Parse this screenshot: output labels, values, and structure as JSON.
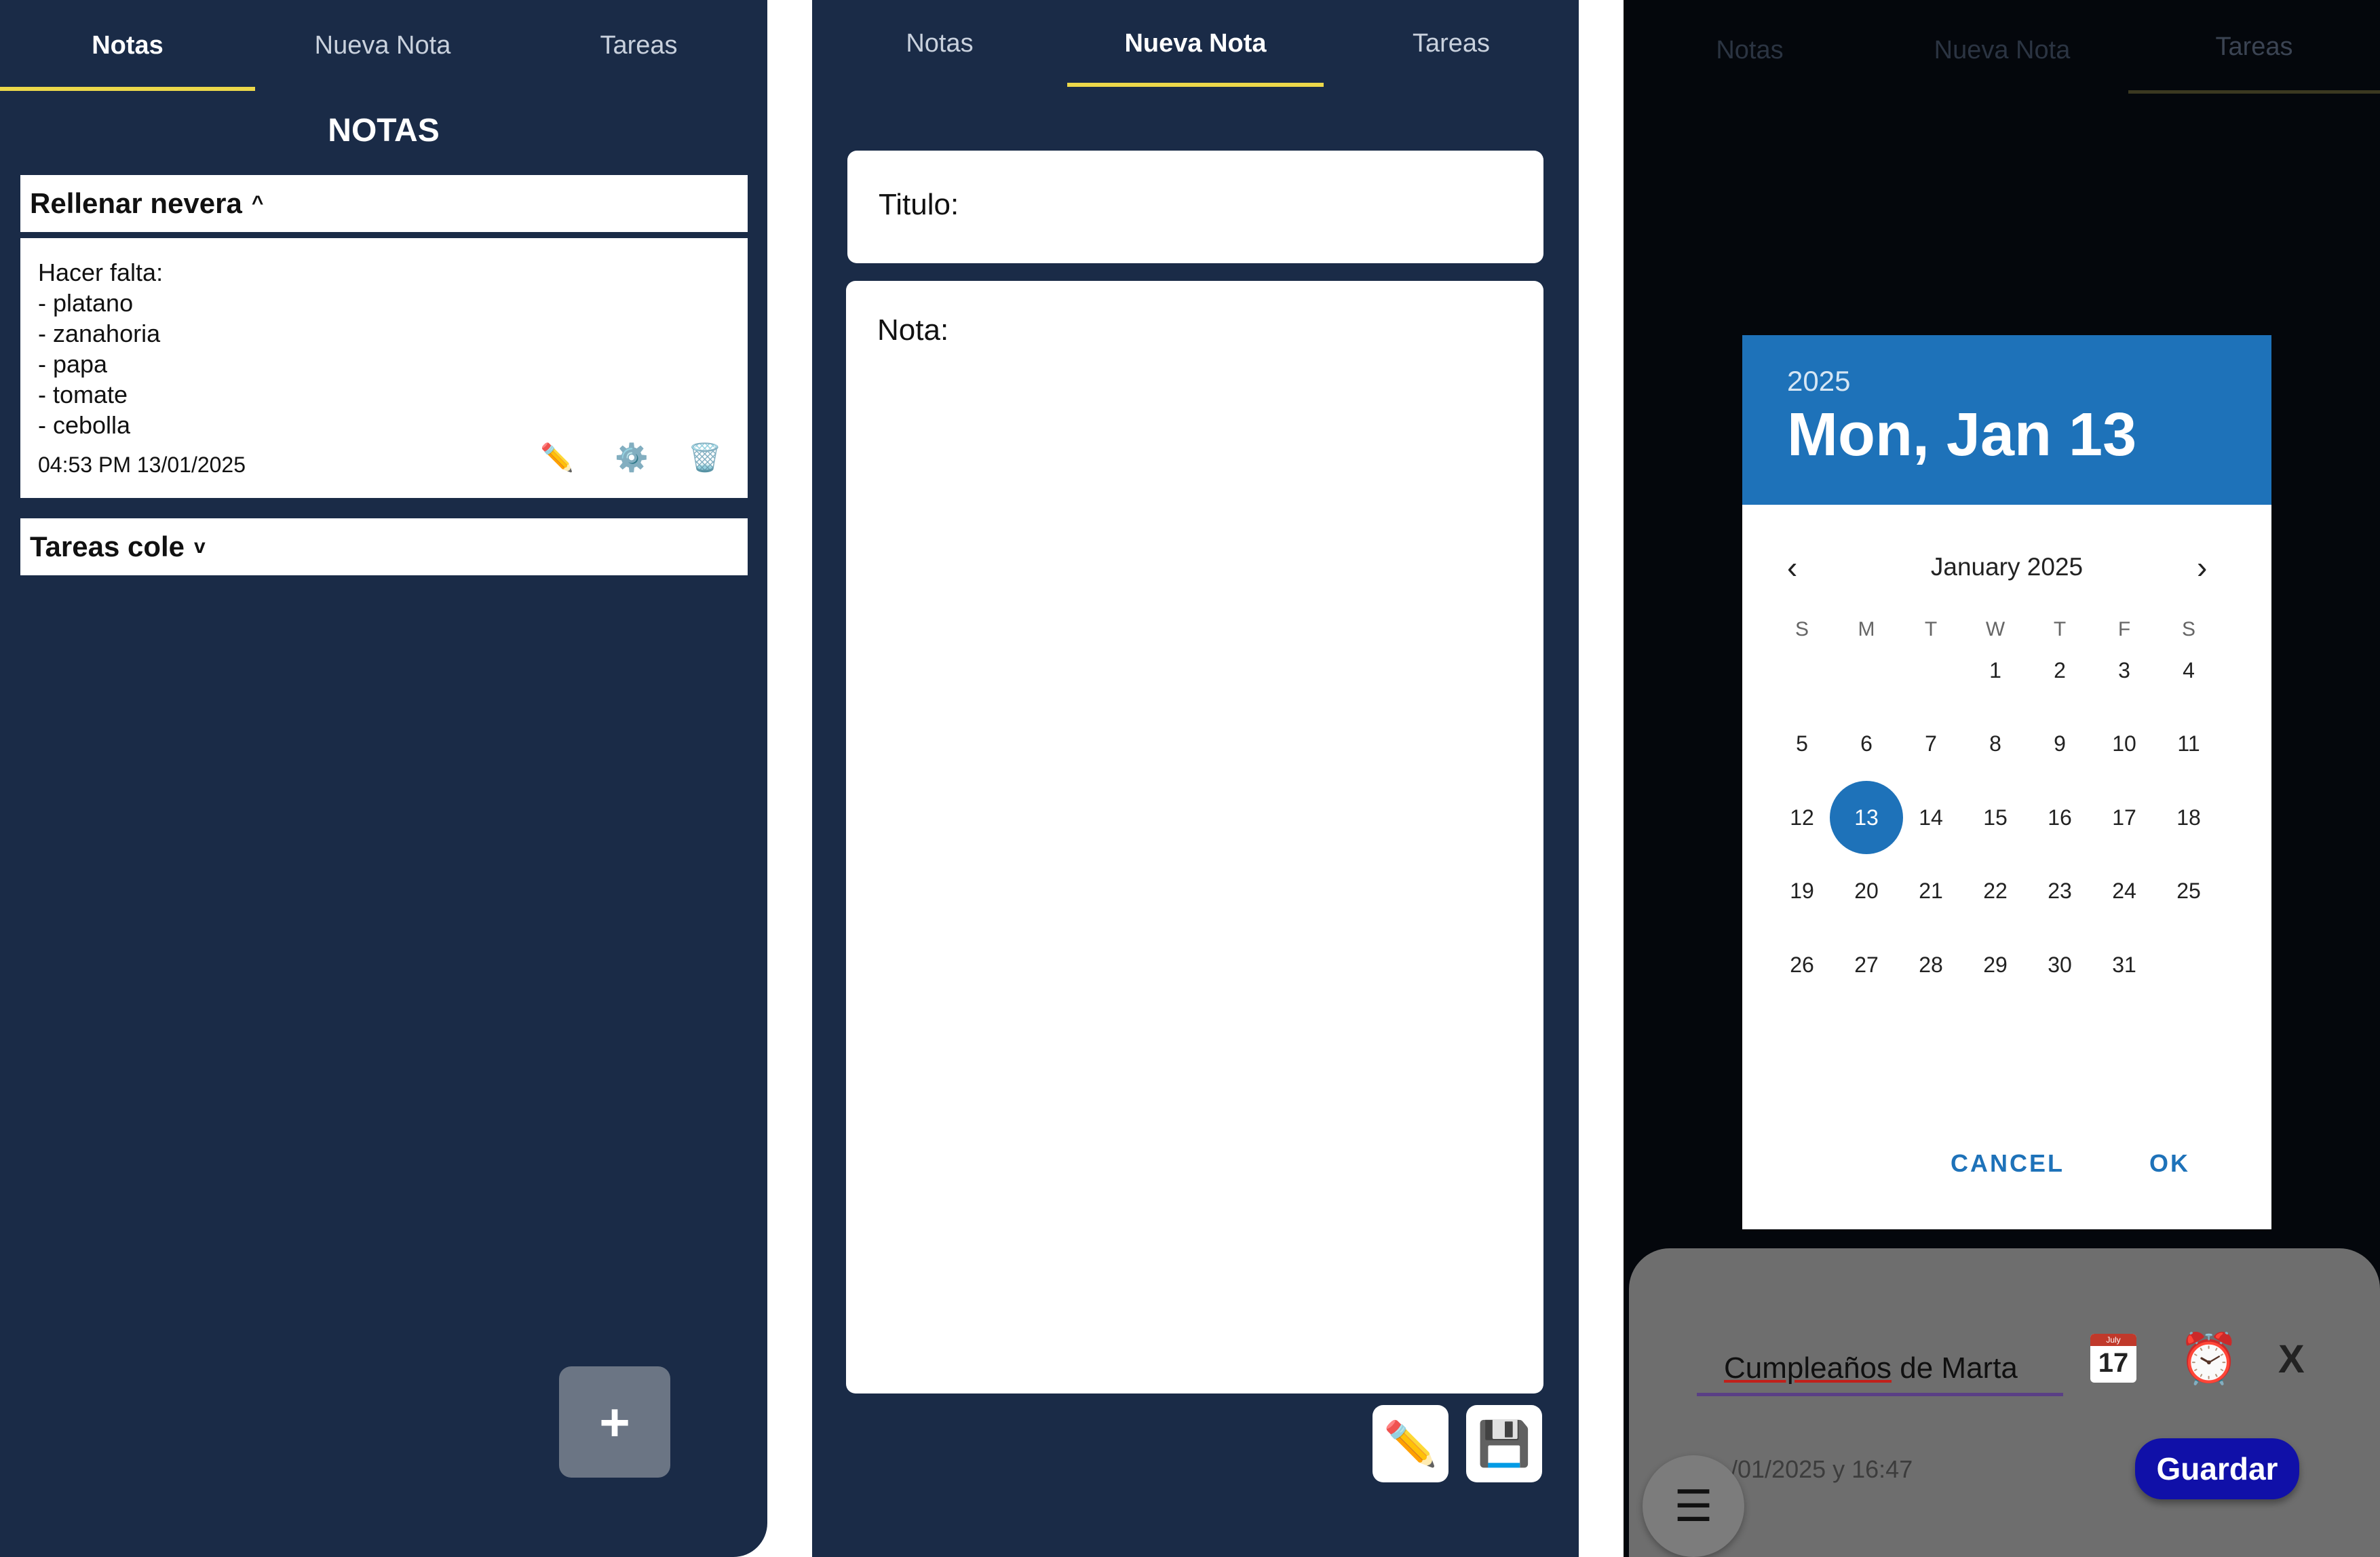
{
  "panel1": {
    "tabs": [
      "Notas",
      "Nueva Nota",
      "Tareas"
    ],
    "active_tab": 0,
    "title": "NOTAS",
    "notes": [
      {
        "title": "Rellenar nevera",
        "toggle": "^",
        "expanded": true,
        "lines": [
          "Hacer falta:",
          "- platano",
          "- zanahoria",
          "- papa",
          "- tomate",
          "- cebolla"
        ],
        "timestamp": "04:53 PM 13/01/2025",
        "actions": [
          "pencil-icon",
          "gear-icon",
          "trash-icon"
        ]
      },
      {
        "title": "Tareas cole",
        "toggle": "v",
        "expanded": false
      }
    ],
    "fab_label": "+"
  },
  "panel2": {
    "tabs": [
      "Notas",
      "Nueva Nota",
      "Tareas"
    ],
    "active_tab": 1,
    "title_placeholder": "Titulo:",
    "note_placeholder": "Nota:",
    "actions": [
      "pencil-icon",
      "save-icon"
    ]
  },
  "panel3": {
    "tabs": [
      "Notas",
      "Nueva Nota",
      "Tareas"
    ],
    "active_tab": 2,
    "date_picker": {
      "year": "2025",
      "selected_label": "Mon, Jan 13",
      "month_label": "January 2025",
      "weekdays": [
        "S",
        "M",
        "T",
        "W",
        "T",
        "F",
        "S"
      ],
      "weeks": [
        [
          "",
          "",
          "",
          "1",
          "2",
          "3",
          "4"
        ],
        [
          "5",
          "6",
          "7",
          "8",
          "9",
          "10",
          "11"
        ],
        [
          "12",
          "13",
          "14",
          "15",
          "16",
          "17",
          "18"
        ],
        [
          "19",
          "20",
          "21",
          "22",
          "23",
          "24",
          "25"
        ],
        [
          "26",
          "27",
          "28",
          "29",
          "30",
          "31",
          ""
        ]
      ],
      "selected_day": "13",
      "cancel_label": "CANCEL",
      "ok_label": "OK",
      "accent": "#1e72b9"
    },
    "task_form": {
      "input_value_underlined": "Cumpleaños",
      "input_value_rest": " de Marta",
      "calendar_icon_day": "17",
      "calendar_icon_month": "July",
      "close_label": "X",
      "date_time": "/01/2025 y 16:47",
      "save_label": "Guardar",
      "menu_icon": "☰"
    }
  },
  "colors": {
    "navy": "#1a2b47",
    "tab_indicator": "#ecd84a",
    "save_button": "#1010a8"
  }
}
